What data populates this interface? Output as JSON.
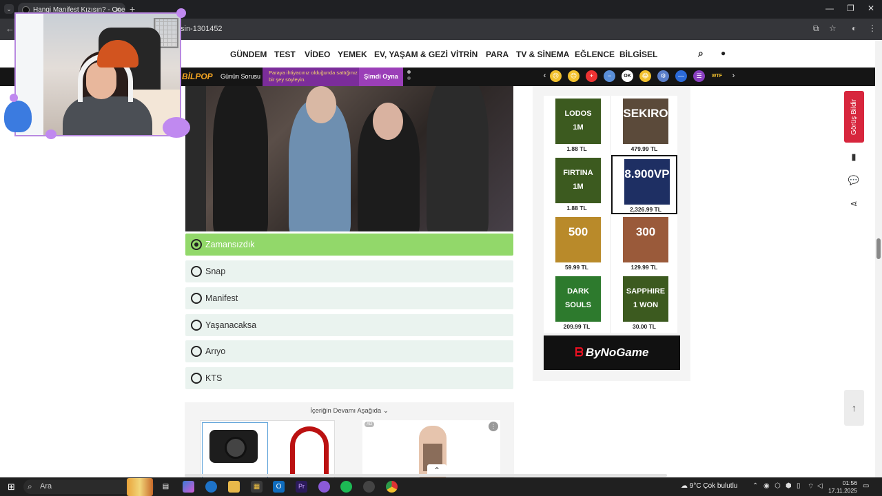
{
  "browser": {
    "tab_title": "Hangi Manifest Kızısın? - Oned",
    "tab_close": "✕",
    "new_tab": "+",
    "url": "sin-1301452",
    "window_controls": [
      "—",
      "❐",
      "✕"
    ]
  },
  "site": {
    "nav": [
      "GÜNDEM",
      "TEST",
      "VİDEO",
      "YEMEK",
      "EV, YAŞAM & GEZİ",
      "VİTRİN",
      "PARA",
      "TV & SİNEMA",
      "EĞLENCE",
      "BİLGİSEL"
    ],
    "promo": {
      "logo": "BİLPOP",
      "question_label": "Günün Sorusu",
      "question_text": "Paraya ihtiyacınız olduğunda sattığınız bir şey söyleyin.",
      "play_label": "Şimdi Oyna"
    },
    "emoji_reactions": [
      "😢",
      "😊",
      "+",
      "−",
      "OK",
      "😂",
      "⚙",
      "—",
      "☰",
      "WTF"
    ]
  },
  "quiz": {
    "options": [
      {
        "label": "Zamansızdık",
        "selected": true
      },
      {
        "label": "Snap",
        "selected": false
      },
      {
        "label": "Manifest",
        "selected": false
      },
      {
        "label": "Yaşanacaksa",
        "selected": false
      },
      {
        "label": "Arıyo",
        "selected": false
      },
      {
        "label": "KTS",
        "selected": false
      }
    ],
    "selected_color": "#92d86a"
  },
  "continue_text": "İçeriğin Devamı Aşağıda",
  "ad_badge": "AD",
  "sidebar_ad": {
    "products": [
      {
        "thumb": "LODOS\n1M",
        "price": "1.88 TL",
        "color": "#3c5a1f"
      },
      {
        "thumb": "SEKIRO",
        "price": "479.99 TL",
        "color": "#5b4a3a"
      },
      {
        "thumb": "FIRTINA\n1M",
        "price": "1.88 TL",
        "color": "#3c5a1f"
      },
      {
        "thumb": "8.900VP",
        "price": "2,326.99 TL",
        "color": "#1e2f63"
      },
      {
        "thumb": "500",
        "price": "59.99 TL",
        "color": "#b98a2a"
      },
      {
        "thumb": "300",
        "price": "129.99 TL",
        "color": "#9a5a3a"
      },
      {
        "thumb": "DARK SOULS",
        "price": "209.99 TL",
        "color": "#2d7a2d"
      },
      {
        "thumb": "SAPPHIRE\n1 WON",
        "price": "30.00 TL",
        "color": "#3c5a1f"
      }
    ],
    "brand": "ByNoGame"
  },
  "feedback_label": "Görüş Bildir",
  "taskbar": {
    "search_placeholder": "Ara",
    "weather": "9°C  Çok bulutlu",
    "time": "01:56",
    "date": "17.11.2025"
  }
}
